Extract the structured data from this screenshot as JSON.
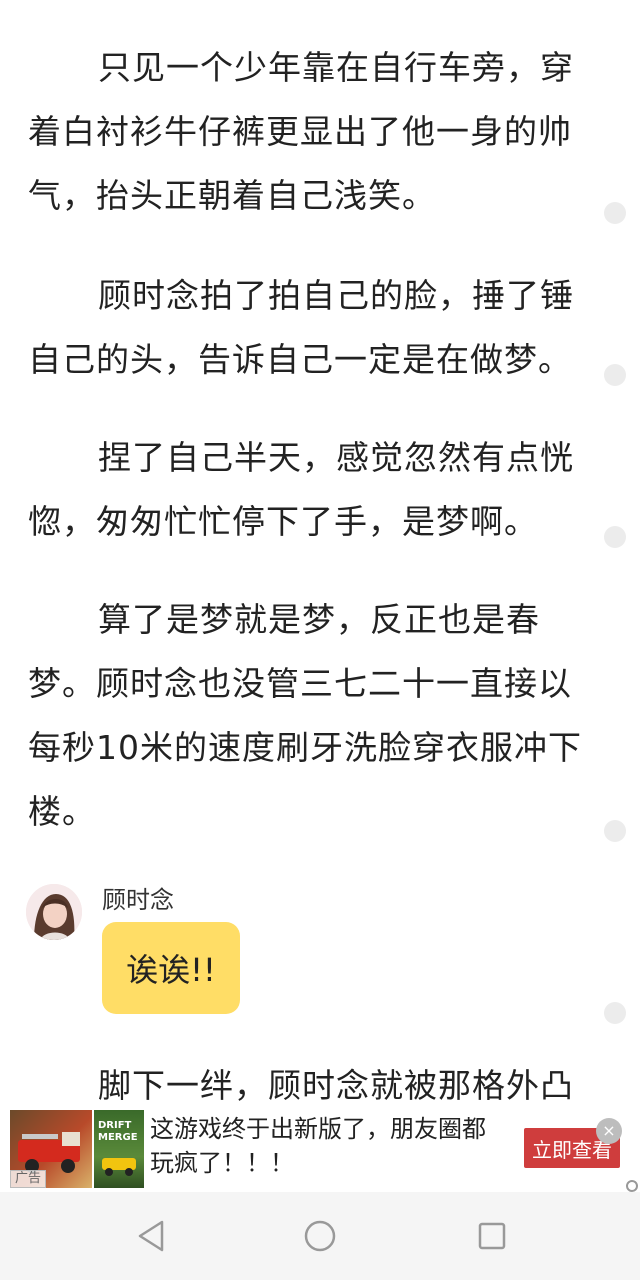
{
  "reader": {
    "paragraphs": [
      "只见一个少年靠在自行车旁，穿着白衬衫牛仔裤更显出了他一身的帅气，抬头正朝着自己浅笑。",
      "顾时念拍了拍自己的脸，捶了锤自己的头，告诉自己一定是在做梦。",
      "捏了自己半天，感觉忽然有点恍惚，匆匆忙忙停下了手，是梦啊。",
      "算了是梦就是梦，反正也是春梦。顾时念也没管三七二十一直接以每秒10米的速度刷牙洗脸穿衣服冲下楼。"
    ],
    "chat": {
      "speaker": "顾时念",
      "message": "诶诶!!"
    },
    "next_paragraph": "脚下一绊，顾时念就被那格外凸"
  },
  "ad": {
    "text": "这游戏终于出新版了，朋友圈都玩疯了！！！",
    "button": "立即查看",
    "badge": "广告",
    "image_text": "DRIFT MERGE",
    "close_glyph": "×"
  },
  "colors": {
    "bubble": "#ffdd66",
    "ad_button": "#cf3d3d",
    "comment_dot": "#ececec"
  },
  "icons": [
    "comment-dot-icon",
    "back-icon",
    "home-icon",
    "recents-icon",
    "close-icon",
    "info-icon"
  ]
}
